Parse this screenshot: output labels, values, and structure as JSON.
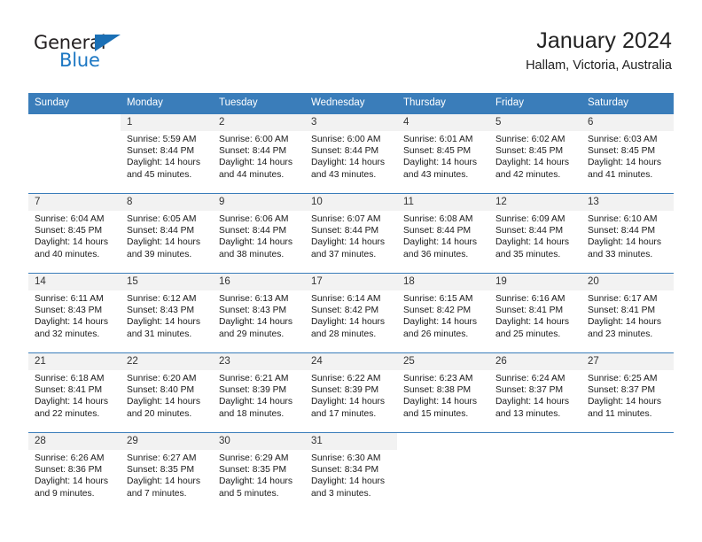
{
  "logo": {
    "word_top": "General",
    "word_bottom": "Blue",
    "triangle_icon": "triangle-icon",
    "brand_blue": "#1c77c3",
    "brand_dark": "#231f20"
  },
  "header": {
    "title": "January 2024",
    "subtitle": "Hallam, Victoria, Australia",
    "accent_color": "#3a7dba",
    "daynum_band_color": "#f2f2f2"
  },
  "calendar": {
    "weekday_headers": [
      "Sunday",
      "Monday",
      "Tuesday",
      "Wednesday",
      "Thursday",
      "Friday",
      "Saturday"
    ],
    "labels": {
      "sunrise": "Sunrise:",
      "sunset": "Sunset:",
      "daylight": "Daylight:"
    },
    "weeks": [
      [
        {
          "day": "",
          "blank": true
        },
        {
          "day": "1",
          "sunrise": "Sunrise: 5:59 AM",
          "sunset": "Sunset: 8:44 PM",
          "daylight_line1": "Daylight: 14 hours",
          "daylight_line2": "and 45 minutes."
        },
        {
          "day": "2",
          "sunrise": "Sunrise: 6:00 AM",
          "sunset": "Sunset: 8:44 PM",
          "daylight_line1": "Daylight: 14 hours",
          "daylight_line2": "and 44 minutes."
        },
        {
          "day": "3",
          "sunrise": "Sunrise: 6:00 AM",
          "sunset": "Sunset: 8:44 PM",
          "daylight_line1": "Daylight: 14 hours",
          "daylight_line2": "and 43 minutes."
        },
        {
          "day": "4",
          "sunrise": "Sunrise: 6:01 AM",
          "sunset": "Sunset: 8:45 PM",
          "daylight_line1": "Daylight: 14 hours",
          "daylight_line2": "and 43 minutes."
        },
        {
          "day": "5",
          "sunrise": "Sunrise: 6:02 AM",
          "sunset": "Sunset: 8:45 PM",
          "daylight_line1": "Daylight: 14 hours",
          "daylight_line2": "and 42 minutes."
        },
        {
          "day": "6",
          "sunrise": "Sunrise: 6:03 AM",
          "sunset": "Sunset: 8:45 PM",
          "daylight_line1": "Daylight: 14 hours",
          "daylight_line2": "and 41 minutes."
        }
      ],
      [
        {
          "day": "7",
          "sunrise": "Sunrise: 6:04 AM",
          "sunset": "Sunset: 8:45 PM",
          "daylight_line1": "Daylight: 14 hours",
          "daylight_line2": "and 40 minutes."
        },
        {
          "day": "8",
          "sunrise": "Sunrise: 6:05 AM",
          "sunset": "Sunset: 8:44 PM",
          "daylight_line1": "Daylight: 14 hours",
          "daylight_line2": "and 39 minutes."
        },
        {
          "day": "9",
          "sunrise": "Sunrise: 6:06 AM",
          "sunset": "Sunset: 8:44 PM",
          "daylight_line1": "Daylight: 14 hours",
          "daylight_line2": "and 38 minutes."
        },
        {
          "day": "10",
          "sunrise": "Sunrise: 6:07 AM",
          "sunset": "Sunset: 8:44 PM",
          "daylight_line1": "Daylight: 14 hours",
          "daylight_line2": "and 37 minutes."
        },
        {
          "day": "11",
          "sunrise": "Sunrise: 6:08 AM",
          "sunset": "Sunset: 8:44 PM",
          "daylight_line1": "Daylight: 14 hours",
          "daylight_line2": "and 36 minutes."
        },
        {
          "day": "12",
          "sunrise": "Sunrise: 6:09 AM",
          "sunset": "Sunset: 8:44 PM",
          "daylight_line1": "Daylight: 14 hours",
          "daylight_line2": "and 35 minutes."
        },
        {
          "day": "13",
          "sunrise": "Sunrise: 6:10 AM",
          "sunset": "Sunset: 8:44 PM",
          "daylight_line1": "Daylight: 14 hours",
          "daylight_line2": "and 33 minutes."
        }
      ],
      [
        {
          "day": "14",
          "sunrise": "Sunrise: 6:11 AM",
          "sunset": "Sunset: 8:43 PM",
          "daylight_line1": "Daylight: 14 hours",
          "daylight_line2": "and 32 minutes."
        },
        {
          "day": "15",
          "sunrise": "Sunrise: 6:12 AM",
          "sunset": "Sunset: 8:43 PM",
          "daylight_line1": "Daylight: 14 hours",
          "daylight_line2": "and 31 minutes."
        },
        {
          "day": "16",
          "sunrise": "Sunrise: 6:13 AM",
          "sunset": "Sunset: 8:43 PM",
          "daylight_line1": "Daylight: 14 hours",
          "daylight_line2": "and 29 minutes."
        },
        {
          "day": "17",
          "sunrise": "Sunrise: 6:14 AM",
          "sunset": "Sunset: 8:42 PM",
          "daylight_line1": "Daylight: 14 hours",
          "daylight_line2": "and 28 minutes."
        },
        {
          "day": "18",
          "sunrise": "Sunrise: 6:15 AM",
          "sunset": "Sunset: 8:42 PM",
          "daylight_line1": "Daylight: 14 hours",
          "daylight_line2": "and 26 minutes."
        },
        {
          "day": "19",
          "sunrise": "Sunrise: 6:16 AM",
          "sunset": "Sunset: 8:41 PM",
          "daylight_line1": "Daylight: 14 hours",
          "daylight_line2": "and 25 minutes."
        },
        {
          "day": "20",
          "sunrise": "Sunrise: 6:17 AM",
          "sunset": "Sunset: 8:41 PM",
          "daylight_line1": "Daylight: 14 hours",
          "daylight_line2": "and 23 minutes."
        }
      ],
      [
        {
          "day": "21",
          "sunrise": "Sunrise: 6:18 AM",
          "sunset": "Sunset: 8:41 PM",
          "daylight_line1": "Daylight: 14 hours",
          "daylight_line2": "and 22 minutes."
        },
        {
          "day": "22",
          "sunrise": "Sunrise: 6:20 AM",
          "sunset": "Sunset: 8:40 PM",
          "daylight_line1": "Daylight: 14 hours",
          "daylight_line2": "and 20 minutes."
        },
        {
          "day": "23",
          "sunrise": "Sunrise: 6:21 AM",
          "sunset": "Sunset: 8:39 PM",
          "daylight_line1": "Daylight: 14 hours",
          "daylight_line2": "and 18 minutes."
        },
        {
          "day": "24",
          "sunrise": "Sunrise: 6:22 AM",
          "sunset": "Sunset: 8:39 PM",
          "daylight_line1": "Daylight: 14 hours",
          "daylight_line2": "and 17 minutes."
        },
        {
          "day": "25",
          "sunrise": "Sunrise: 6:23 AM",
          "sunset": "Sunset: 8:38 PM",
          "daylight_line1": "Daylight: 14 hours",
          "daylight_line2": "and 15 minutes."
        },
        {
          "day": "26",
          "sunrise": "Sunrise: 6:24 AM",
          "sunset": "Sunset: 8:37 PM",
          "daylight_line1": "Daylight: 14 hours",
          "daylight_line2": "and 13 minutes."
        },
        {
          "day": "27",
          "sunrise": "Sunrise: 6:25 AM",
          "sunset": "Sunset: 8:37 PM",
          "daylight_line1": "Daylight: 14 hours",
          "daylight_line2": "and 11 minutes."
        }
      ],
      [
        {
          "day": "28",
          "sunrise": "Sunrise: 6:26 AM",
          "sunset": "Sunset: 8:36 PM",
          "daylight_line1": "Daylight: 14 hours",
          "daylight_line2": "and 9 minutes."
        },
        {
          "day": "29",
          "sunrise": "Sunrise: 6:27 AM",
          "sunset": "Sunset: 8:35 PM",
          "daylight_line1": "Daylight: 14 hours",
          "daylight_line2": "and 7 minutes."
        },
        {
          "day": "30",
          "sunrise": "Sunrise: 6:29 AM",
          "sunset": "Sunset: 8:35 PM",
          "daylight_line1": "Daylight: 14 hours",
          "daylight_line2": "and 5 minutes."
        },
        {
          "day": "31",
          "sunrise": "Sunrise: 6:30 AM",
          "sunset": "Sunset: 8:34 PM",
          "daylight_line1": "Daylight: 14 hours",
          "daylight_line2": "and 3 minutes."
        },
        {
          "day": "",
          "blank": true
        },
        {
          "day": "",
          "blank": true
        },
        {
          "day": "",
          "blank": true
        }
      ]
    ]
  }
}
